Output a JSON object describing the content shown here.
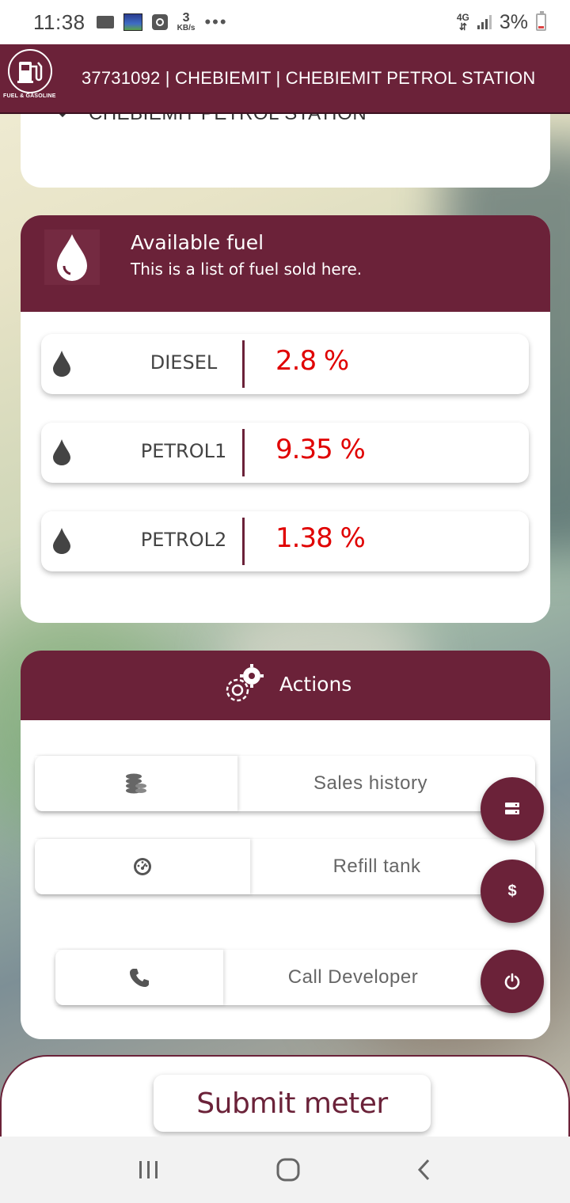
{
  "status_bar": {
    "time": "11:38",
    "speed_value": "3",
    "speed_unit": "KB/s",
    "more": "•••",
    "network": "4G",
    "battery": "3%"
  },
  "app_bar": {
    "title": "37731092 | CHEBIEMIT | CHEBIEMIT PETROL STATION",
    "logo_caption": "FUEL & GASOLINE"
  },
  "top_card": {
    "partial_text": "CHEBIEMIT PETROL STATION"
  },
  "fuel_section": {
    "title": "Available fuel",
    "subtitle": "This is a list of fuel sold here.",
    "items": [
      {
        "name": "DIESEL",
        "percent": "2.8 %"
      },
      {
        "name": "PETROL1",
        "percent": "9.35 %"
      },
      {
        "name": "PETROL2",
        "percent": "1.38 %"
      }
    ]
  },
  "actions": {
    "title": "Actions",
    "buttons": [
      {
        "label": "Sales history",
        "icon": "coins-icon"
      },
      {
        "label": "Refill tank",
        "icon": "gauge-icon"
      },
      {
        "label": "Call Developer",
        "icon": "phone-icon"
      }
    ],
    "fabs": [
      {
        "icon": "server-icon"
      },
      {
        "icon": "dollar-icon",
        "label": "$"
      },
      {
        "icon": "power-icon"
      }
    ]
  },
  "submit": {
    "label": "Submit meter"
  },
  "colors": {
    "primary": "#6b2239",
    "percent": "#e00000"
  }
}
